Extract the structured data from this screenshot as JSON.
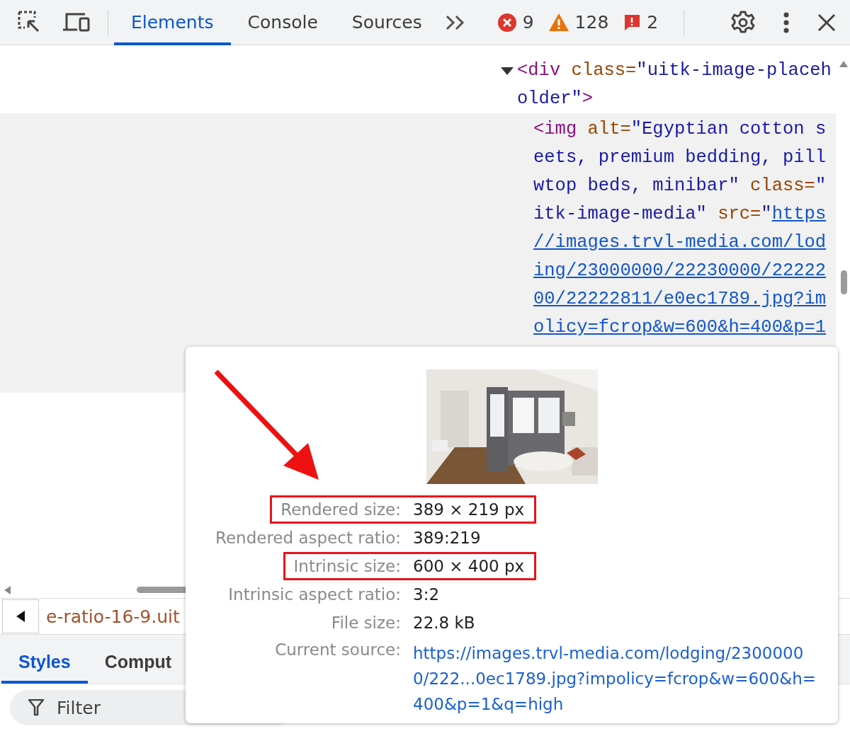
{
  "toolbar": {
    "tabs": [
      {
        "label": "Elements",
        "selected": true
      },
      {
        "label": "Console",
        "selected": false
      },
      {
        "label": "Sources",
        "selected": false
      }
    ],
    "counters": [
      {
        "kind": "error",
        "count": "9"
      },
      {
        "kind": "warning",
        "count": "128"
      },
      {
        "kind": "issue",
        "count": "2"
      }
    ]
  },
  "dom_tree": {
    "nodes": [
      {
        "expanded": true,
        "selected": false,
        "lines": [
          [
            {
              "kind": "tag",
              "text": "<div"
            },
            {
              "kind": "attr",
              "text": " class="
            },
            {
              "kind": "value",
              "text": "\"uitk-image-placeh"
            }
          ],
          [
            {
              "kind": "value",
              "text": "older\""
            },
            {
              "kind": "tag",
              "text": ">"
            }
          ]
        ],
        "children": [
          {
            "selected": true,
            "lines": [
              [
                {
                  "kind": "tag",
                  "text": "<img"
                },
                {
                  "kind": "attr",
                  "text": " alt="
                },
                {
                  "kind": "value",
                  "text": "\"Egyptian cotton s"
                }
              ],
              [
                {
                  "kind": "value",
                  "text": "eets, premium bedding, pill"
                }
              ],
              [
                {
                  "kind": "value",
                  "text": "wtop beds, minibar\""
                },
                {
                  "kind": "attr",
                  "text": " class="
                },
                {
                  "kind": "value",
                  "text": "\""
                }
              ],
              [
                {
                  "kind": "value",
                  "text": "itk-image-media\""
                },
                {
                  "kind": "attr",
                  "text": " src="
                },
                {
                  "kind": "value",
                  "text": "\""
                },
                {
                  "kind": "link",
                  "text": "https"
                }
              ],
              [
                {
                  "kind": "link",
                  "text": "//images.trvl-media.com/lod"
                }
              ],
              [
                {
                  "kind": "link",
                  "text": "ing/23000000/22230000/22222"
                }
              ],
              [
                {
                  "kind": "link",
                  "text": "00/22222811/e0ec1789.jpg?im"
                }
              ],
              [
                {
                  "kind": "link",
                  "text": "olicy=fcrop&w=600&h=400&p=1"
                }
              ]
            ]
          }
        ]
      }
    ]
  },
  "breadcrumb": {
    "text": "e-ratio-16-9.uit"
  },
  "styles_tabs": [
    {
      "label": "Styles",
      "selected": true
    },
    {
      "label": "Comput",
      "selected": false
    }
  ],
  "filter": {
    "placeholder": "Filter"
  },
  "image_tooltip": {
    "rows": [
      {
        "label": "Rendered size:",
        "value": "389 × 219 px",
        "highlighted": true,
        "kind": "text"
      },
      {
        "label": "Rendered aspect ratio:",
        "value": "389:219",
        "highlighted": false,
        "kind": "text"
      },
      {
        "label": "Intrinsic size:",
        "value": "600 × 400 px",
        "highlighted": true,
        "kind": "text"
      },
      {
        "label": "Intrinsic aspect ratio:",
        "value": "3:2",
        "highlighted": false,
        "kind": "text"
      },
      {
        "label": "File size:",
        "value": "22.8 kB",
        "highlighted": false,
        "kind": "text"
      },
      {
        "label": "Current source:",
        "value": "https://images.trvl-media.com/lodging/23000000/222...0ec1789.jpg?impolicy=fcrop&w=600&h=400&p=1&q=high",
        "highlighted": false,
        "kind": "link"
      }
    ]
  }
}
